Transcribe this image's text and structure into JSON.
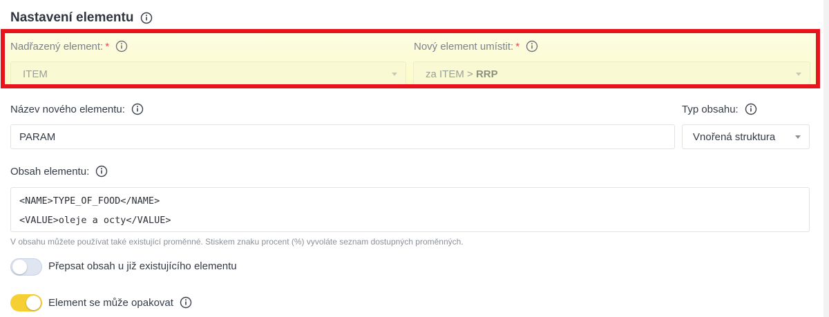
{
  "section": {
    "title": "Nastavení elementu"
  },
  "parent_element": {
    "label": "Nadřazený element:",
    "required_mark": "*",
    "value": "ITEM"
  },
  "placement": {
    "label": "Nový element umístit:",
    "required_mark": "*",
    "value_prefix": "za ITEM > ",
    "value_strong": "RRP"
  },
  "new_element_name": {
    "label": "Název nového elementu:",
    "value": "PARAM"
  },
  "content_type": {
    "label": "Typ obsahu:",
    "value": "Vnořená struktura"
  },
  "element_content": {
    "label": "Obsah elementu:",
    "lines": [
      "<NAME>TYPE_OF_FOOD</NAME>",
      "<VALUE>oleje a octy</VALUE>"
    ],
    "hint": "V obsahu můžete používat také existující proměnné. Stiskem znaku procent (%) vyvoláte seznam dostupných proměnných."
  },
  "toggles": {
    "overwrite": {
      "label": "Přepsat obsah u již existujícího elementu",
      "state": "off"
    },
    "repeat": {
      "label": "Element se může opakovat",
      "state": "on"
    }
  },
  "colors": {
    "accent_yellow": "#f6cf34",
    "highlight_frame": "#e8141c",
    "required_star": "#e8494f"
  }
}
